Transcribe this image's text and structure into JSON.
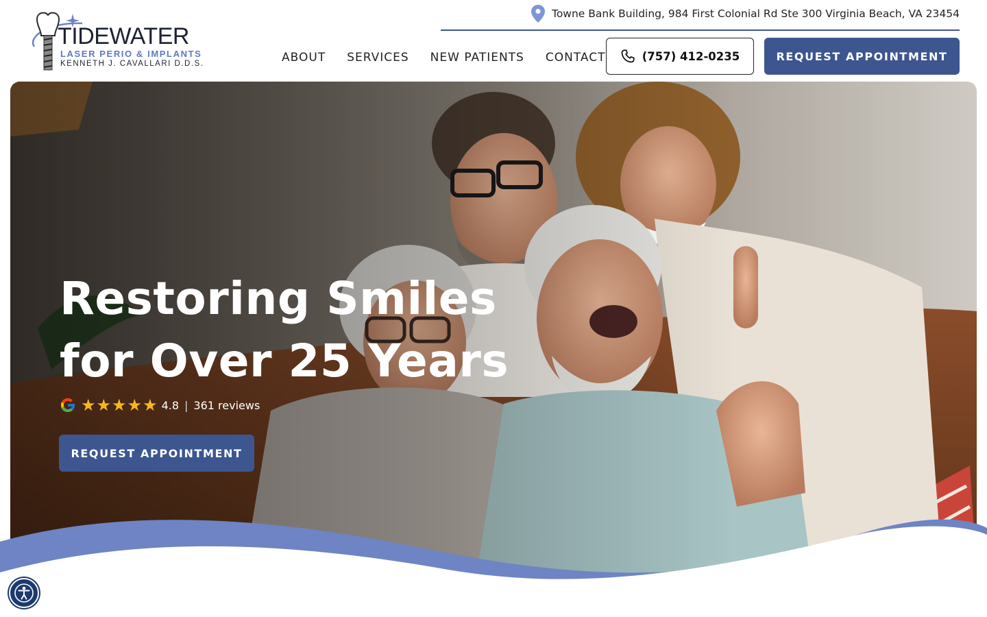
{
  "brand": {
    "name": "TIDEWATER",
    "tagline": "LASER PERIO & IMPLANTS",
    "doctor": "KENNETH J. CAVALLARI D.D.S."
  },
  "header": {
    "address": "Towne Bank Building, 984 First Colonial Rd Ste 300 Virginia Beach, VA 23454",
    "nav": [
      "ABOUT",
      "SERVICES",
      "NEW PATIENTS",
      "CONTACT"
    ],
    "phone": "(757) 412-0235",
    "cta": "REQUEST APPOINTMENT"
  },
  "hero": {
    "title_line1": "Restoring Smiles",
    "title_line2": "for Over 25 Years",
    "rating": "4.8",
    "separator": "|",
    "reviews": "361 reviews",
    "cta": "REQUEST APPOINTMENT"
  },
  "icons": {
    "location": "map-pin-icon",
    "phone": "phone-icon",
    "google": "google-icon",
    "star": "star-icon",
    "accessibility": "accessibility-icon"
  },
  "colors": {
    "brand_blue": "#3d5690",
    "wave_blue": "#6e84c4",
    "star": "#f6b81b"
  }
}
